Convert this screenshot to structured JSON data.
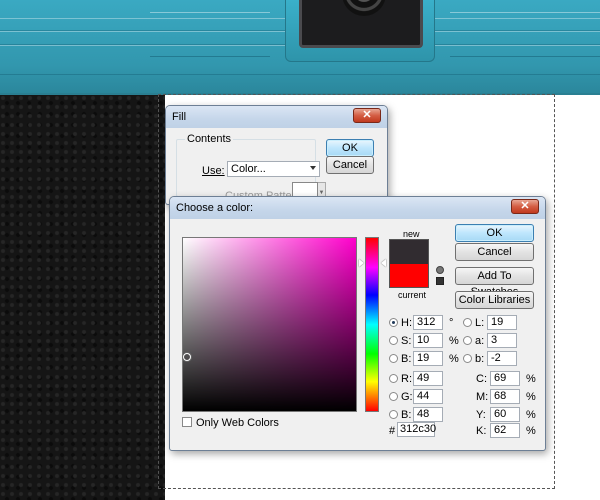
{
  "fill_dialog": {
    "title": "Fill",
    "contents_legend": "Contents",
    "use_label": "Use:",
    "use_value": "Color...",
    "custom_pattern_label": "Custom Pattern:",
    "ok_label": "OK",
    "cancel_label": "Cancel"
  },
  "color_picker": {
    "title": "Choose a color:",
    "new_label": "new",
    "current_label": "current",
    "new_color": "#312c30",
    "current_color": "#ff0000",
    "buttons": {
      "ok": "OK",
      "cancel": "Cancel",
      "add_to_swatches": "Add To Swatches",
      "color_libraries": "Color Libraries"
    },
    "only_web_colors_label": "Only Web Colors",
    "hsb": [
      {
        "label": "H:",
        "value": "312",
        "unit": "°",
        "selected": true
      },
      {
        "label": "S:",
        "value": "10",
        "unit": "%",
        "selected": false
      },
      {
        "label": "B:",
        "value": "19",
        "unit": "%",
        "selected": false
      }
    ],
    "rgb": [
      {
        "label": "R:",
        "value": "49"
      },
      {
        "label": "G:",
        "value": "44"
      },
      {
        "label": "B:",
        "value": "48"
      }
    ],
    "lab": [
      {
        "label": "L:",
        "value": "19"
      },
      {
        "label": "a:",
        "value": "3"
      },
      {
        "label": "b:",
        "value": "-2"
      }
    ],
    "cmyk": [
      {
        "label": "C:",
        "value": "69",
        "unit": "%"
      },
      {
        "label": "M:",
        "value": "68",
        "unit": "%"
      },
      {
        "label": "Y:",
        "value": "60",
        "unit": "%"
      },
      {
        "label": "K:",
        "value": "62",
        "unit": "%"
      }
    ],
    "hex_label": "#",
    "hex_value": "312c30"
  }
}
